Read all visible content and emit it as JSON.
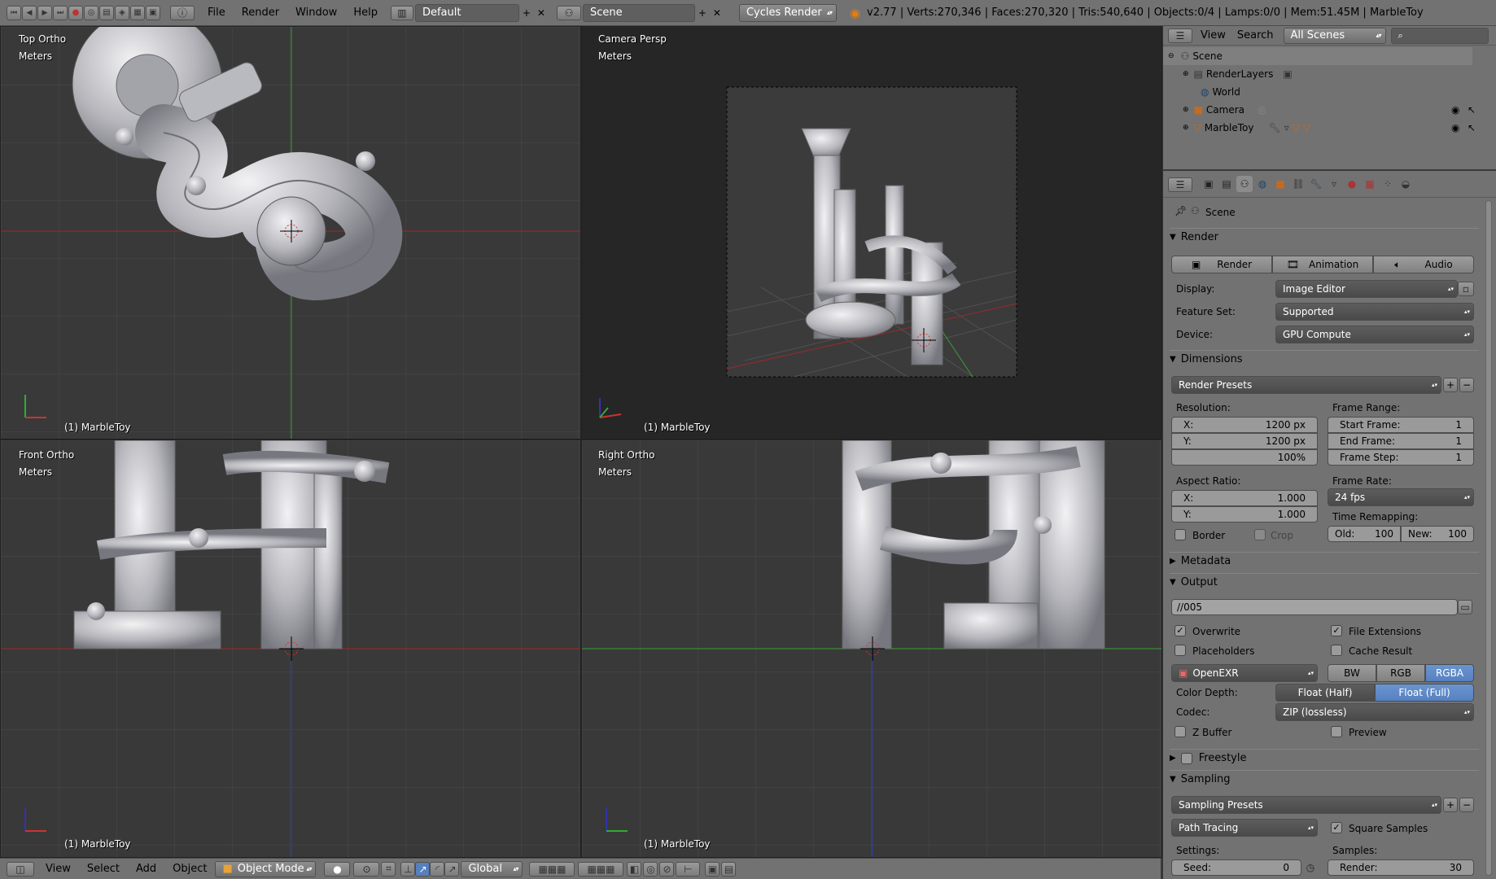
{
  "header": {
    "menus": [
      "File",
      "Render",
      "Window",
      "Help"
    ],
    "layout": "Default",
    "scene": "Scene",
    "engine": "Cycles Render",
    "stats": "v2.77 | Verts:270,346 | Faces:270,320 | Tris:540,640 | Objects:0/4 | Lamps:0/0 | Mem:51.45M | MarbleToy"
  },
  "viewports": {
    "tl": {
      "title": "Top Ortho",
      "units": "Meters",
      "object": "(1) MarbleToy"
    },
    "tr": {
      "title": "Camera Persp",
      "units": "Meters",
      "object": "(1) MarbleToy"
    },
    "bl": {
      "title": "Front Ortho",
      "units": "Meters",
      "object": "(1) MarbleToy"
    },
    "br": {
      "title": "Right Ortho",
      "units": "Meters",
      "object": "(1) MarbleToy"
    }
  },
  "bottombar": {
    "menus": [
      "View",
      "Select",
      "Add",
      "Object"
    ],
    "mode": "Object Mode",
    "orientation": "Global"
  },
  "outliner": {
    "view": "View",
    "search": "Search",
    "scenes": "All Scenes",
    "items": [
      "Scene",
      "RenderLayers",
      "World",
      "Camera",
      "MarbleToy"
    ]
  },
  "props": {
    "context": "Scene",
    "render_panel": "Render",
    "render_btn": "Render",
    "animation_btn": "Animation",
    "audio_btn": "Audio",
    "display_label": "Display:",
    "display_value": "Image Editor",
    "feature_label": "Feature Set:",
    "feature_value": "Supported",
    "device_label": "Device:",
    "device_value": "GPU Compute",
    "dimensions_panel": "Dimensions",
    "render_presets": "Render Presets",
    "resolution_label": "Resolution:",
    "res_x_label": "X:",
    "res_x": "1200 px",
    "res_y_label": "Y:",
    "res_y": "1200 px",
    "res_pct": "100%",
    "frame_range_label": "Frame Range:",
    "start_frame_label": "Start Frame:",
    "start_frame": "1",
    "end_frame_label": "End Frame:",
    "end_frame": "1",
    "frame_step_label": "Frame Step:",
    "frame_step": "1",
    "aspect_label": "Aspect Ratio:",
    "asp_x_label": "X:",
    "asp_x": "1.000",
    "asp_y_label": "Y:",
    "asp_y": "1.000",
    "frame_rate_label": "Frame Rate:",
    "frame_rate": "24 fps",
    "time_remap_label": "Time Remapping:",
    "old_label": "Old:",
    "old": "100",
    "new_label": "New:",
    "new": "100",
    "border": "Border",
    "crop": "Crop",
    "metadata_panel": "Metadata",
    "output_panel": "Output",
    "output_path": "//005",
    "overwrite": "Overwrite",
    "file_ext": "File Extensions",
    "placeholders": "Placeholders",
    "cache_result": "Cache Result",
    "format": "OpenEXR",
    "bw": "BW",
    "rgb": "RGB",
    "rgba": "RGBA",
    "color_depth_label": "Color Depth:",
    "float_half": "Float (Half)",
    "float_full": "Float (Full)",
    "codec_label": "Codec:",
    "codec": "ZIP (lossless)",
    "zbuffer": "Z Buffer",
    "preview": "Preview",
    "freestyle_panel": "Freestyle",
    "sampling_panel": "Sampling",
    "sampling_presets": "Sampling Presets",
    "integrator": "Path Tracing",
    "square_samples": "Square Samples",
    "settings_label": "Settings:",
    "samples_label": "Samples:",
    "seed_label": "Seed:",
    "seed": "0",
    "render_samples_label": "Render:",
    "render_samples": "30"
  }
}
